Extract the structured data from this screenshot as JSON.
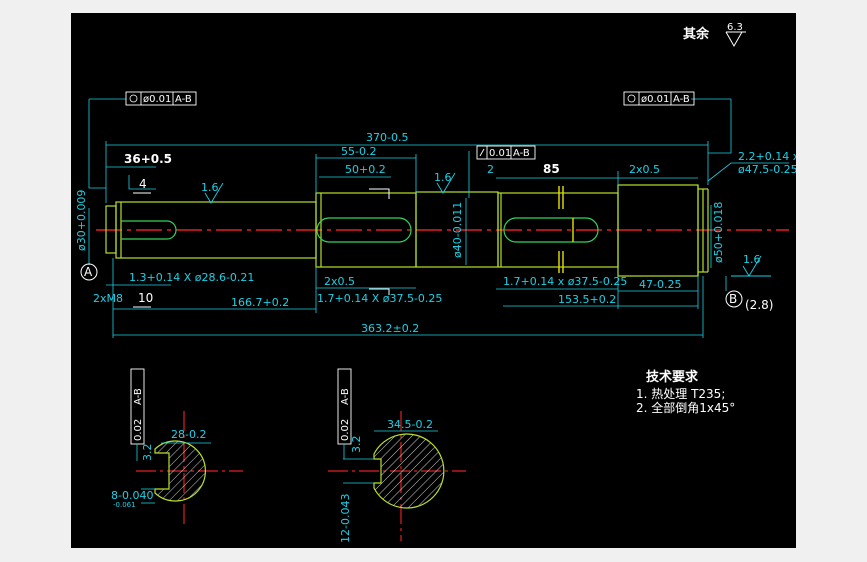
{
  "roughness_note": {
    "label": "其余",
    "value": "6.3"
  },
  "tech": {
    "title": "技术要求",
    "line1": "1. 热处理 T235;",
    "line2": "2. 全部倒角1x45°"
  },
  "tol_frames": {
    "left": {
      "value": "ø0.01",
      "datum": "A-B"
    },
    "right": {
      "value": "ø0.01",
      "datum": "A-B"
    },
    "center": {
      "value": "0.01",
      "datum": "A-B"
    },
    "sec1": {
      "value": "0.02",
      "datum": "A-B"
    },
    "sec2": {
      "value": "0.02",
      "datum": "A-B"
    }
  },
  "datums": {
    "a": "A",
    "b": "B",
    "b_note": "(2.8)"
  },
  "dims": {
    "total_length": "370-0.5",
    "length_363": "363.2±0.2",
    "length_166": "166.7+0.2",
    "length_153": "153.5+0.2",
    "length_55": "55-0.2",
    "length_50": "50+0.2",
    "length_85": "85",
    "length_47": "47-0.25",
    "length_36": "36+0.5",
    "len_2": "2",
    "len_4": "4",
    "chamfer_2x05_top": "2x0.5",
    "chamfer_2x05_bottom": "2x0.5",
    "groove_left": "1.3+0.14 X ø28.6-0.21",
    "groove_mid": "1.7+0.14 X ø37.5-0.25",
    "groove_right_bottom": "1.7+0.14 x ø37.5-0.25",
    "groove_right_top_1": "2.2+0.14 x",
    "groove_right_top_2": "ø47.5-0.25",
    "dia_40": "ø40-0.011",
    "dia_50": "ø50+0.018",
    "dia_30": "ø30+0.009",
    "thread": "2xM8",
    "depth_label": "10",
    "rough_16_1": "1.6",
    "rough_16_2": "1.6",
    "rough_16_3": "1.6",
    "sec1_width": "28-0.2",
    "sec1_key": "8-0.040",
    "sec1_key2": "-0.061",
    "sec1_rough": "3.2",
    "sec2_width": "34.5-0.2",
    "sec2_key": "12-0.043",
    "sec2_rough": "3.2"
  }
}
